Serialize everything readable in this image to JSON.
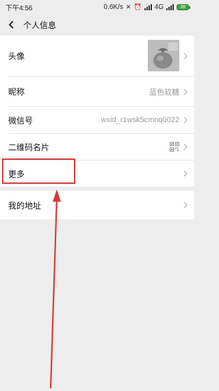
{
  "status_bar": {
    "time": "下午4:56",
    "speed": "0.6K/s",
    "network": "4G",
    "battery": "38"
  },
  "header": {
    "title": "个人信息"
  },
  "rows": {
    "avatar": {
      "label": "头像"
    },
    "nickname": {
      "label": "昵称",
      "value": "蓝色软糖"
    },
    "wechat_id": {
      "label": "微信号",
      "value": "wxid_r1wsk5cmnq0022"
    },
    "qr_card": {
      "label": "二维码名片"
    },
    "more": {
      "label": "更多"
    },
    "address": {
      "label": "我的地址"
    }
  },
  "colors": {
    "annotation": "#d63a3a",
    "background": "#ededed",
    "secondary_text": "#9a9a9a"
  }
}
